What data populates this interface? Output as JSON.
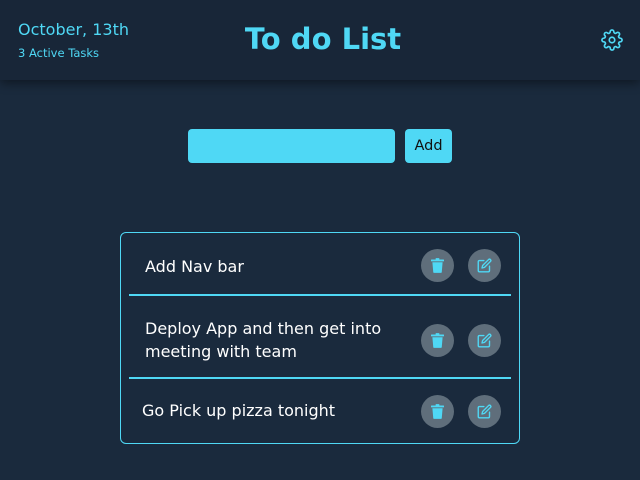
{
  "header": {
    "date": "October, 13th",
    "active_tasks": "3 Active Tasks",
    "title": "To do List",
    "settings_icon": "gear-icon"
  },
  "form": {
    "input_value": "",
    "input_placeholder": "",
    "add_label": "Add"
  },
  "tasks": [
    {
      "text": "Add Nav bar",
      "delete_icon": "trash-icon",
      "edit_icon": "edit-icon"
    },
    {
      "text": "Deploy App and then get into meeting with team",
      "delete_icon": "trash-icon",
      "edit_icon": "edit-icon"
    },
    {
      "text": "Go Pick up pizza tonight",
      "delete_icon": "trash-icon",
      "edit_icon": "edit-icon"
    }
  ],
  "colors": {
    "accent": "#4fd8f5",
    "background": "#1a2a3d",
    "header": "#182638",
    "icon_button": "#5f6e7b",
    "task_text": "#ffffff"
  }
}
